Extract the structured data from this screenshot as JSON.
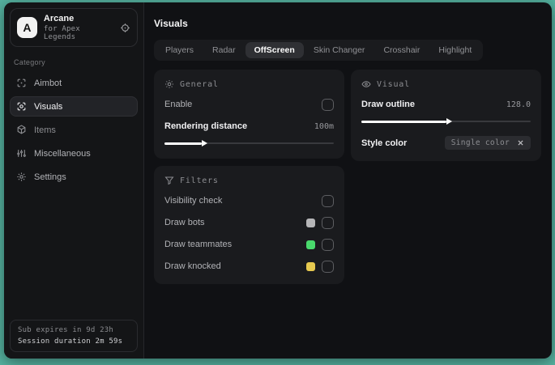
{
  "colors": {
    "desktop": "#55b2a0",
    "swatch_bots": "#b6b6b8",
    "swatch_teammates": "#49d96c",
    "swatch_knocked": "#e6c94f"
  },
  "sidebar": {
    "app_initial": "A",
    "app_title": "Arcane",
    "app_subtitle": "for Apex Legends",
    "category_label": "Category",
    "items": [
      {
        "label": "Aimbot"
      },
      {
        "label": "Visuals"
      },
      {
        "label": "Items"
      },
      {
        "label": "Miscellaneous"
      },
      {
        "label": "Settings"
      }
    ],
    "footer_line1": "Sub expires in 9d 23h",
    "footer_line2": "Session duration 2m 59s"
  },
  "main": {
    "title": "Visuals",
    "tabs": [
      {
        "label": "Players"
      },
      {
        "label": "Radar"
      },
      {
        "label": "OffScreen"
      },
      {
        "label": "Skin Changer"
      },
      {
        "label": "Crosshair"
      },
      {
        "label": "Highlight"
      }
    ]
  },
  "panels": {
    "general": {
      "header": "General",
      "enable_label": "Enable",
      "rendering_label": "Rendering distance",
      "rendering_value": "100m",
      "rendering_fill_pct": "22%"
    },
    "filters": {
      "header": "Filters",
      "rows": [
        {
          "label": "Visibility check"
        },
        {
          "label": "Draw bots"
        },
        {
          "label": "Draw teammates"
        },
        {
          "label": "Draw knocked"
        }
      ]
    },
    "visual": {
      "header": "Visual",
      "outline_label": "Draw outline",
      "outline_value": "128.0",
      "outline_fill_pct": "50%",
      "style_label": "Style color",
      "style_chip_label": "Single color"
    }
  }
}
